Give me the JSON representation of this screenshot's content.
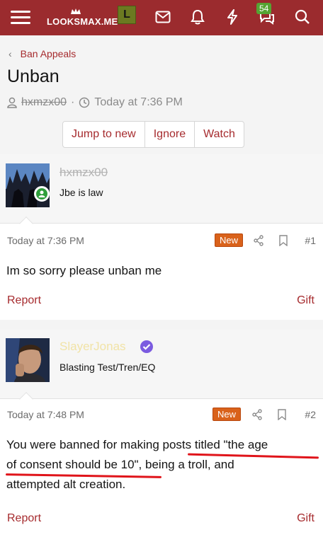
{
  "header": {
    "logo_text": "LOOKSMAX.ME",
    "rank_badge": "L",
    "notifications_count": "54",
    "icons": [
      "menu-icon",
      "mail-icon",
      "bell-icon",
      "bolt-icon",
      "chat-icon",
      "search-icon"
    ]
  },
  "breadcrumb": {
    "label": "Ban Appeals"
  },
  "thread": {
    "title": "Unban",
    "author": "hxmzx00",
    "time": "Today at 7:36 PM"
  },
  "actions": {
    "jump": "Jump to new",
    "ignore": "Ignore",
    "watch": "Watch"
  },
  "posts": [
    {
      "username": "hxmzx00",
      "user_title": "Jbe is law",
      "date": "Today at 7:36 PM",
      "new_label": "New",
      "number": "#1",
      "body": "Im so sorry please unban me",
      "report": "Report",
      "gift": "Gift"
    },
    {
      "username": "SlayerJonas",
      "user_title": "Blasting Test/Tren/EQ",
      "date": "Today at 7:48 PM",
      "new_label": "New",
      "number": "#2",
      "body_line1": "You were banned for making posts titled \"the age",
      "body_line2": "of consent should be 10\", being a troll, and",
      "body_line3": "attempted alt creation.",
      "report": "Report",
      "gift": "Gift"
    }
  ],
  "colors": {
    "brand": "#9b2b2e",
    "link": "#a62b2e",
    "new_badge": "#d9621b",
    "online": "#2f9e3a",
    "verified": "#7b5be0",
    "annotation": "#e0141a"
  }
}
